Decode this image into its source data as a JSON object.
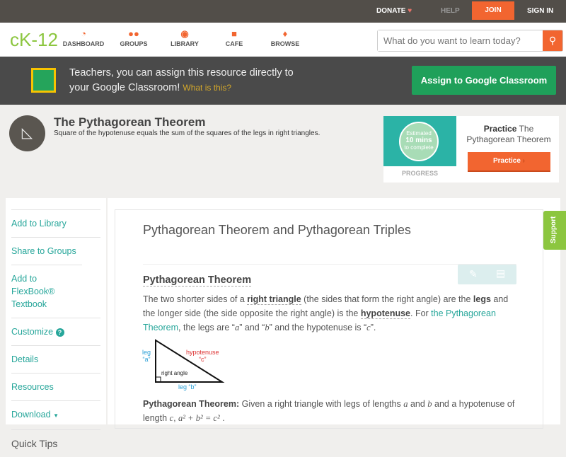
{
  "topbar": {
    "donate": "DONATE",
    "help": "HELP",
    "join": "JOIN",
    "signin": "SIGN IN"
  },
  "nav": {
    "logo": "cK-12",
    "items": [
      {
        "label": "DASHBOARD",
        "icon": "dashboard-icon"
      },
      {
        "label": "GROUPS",
        "icon": "groups-icon"
      },
      {
        "label": "LIBRARY",
        "icon": "library-icon"
      },
      {
        "label": "CAFE",
        "icon": "cafe-icon"
      },
      {
        "label": "BROWSE",
        "icon": "browse-icon"
      }
    ],
    "search_placeholder": "What do you want to learn today?"
  },
  "banner": {
    "line1": "Teachers, you can assign this resource directly to",
    "line2": "your Google Classroom!",
    "link": "What is this?",
    "button": "Assign to Google Classroom"
  },
  "concept": {
    "title": "The Pythagorean Theorem",
    "subtitle": "Square of the hypotenuse equals the sum of the squares of the legs in right triangles."
  },
  "practice": {
    "estimate1": "Estimated",
    "estimate2": "10 mins",
    "estimate3": "to complete",
    "progress": "PROGRESS",
    "title_bold": "Practice",
    "title_rest": " The Pythagorean Theorem",
    "button": "Practice"
  },
  "sidebar": {
    "items": [
      "Add to Library",
      "Share to Groups",
      "Add to FlexBook® Textbook",
      "Customize",
      "Details",
      "Resources",
      "Download"
    ],
    "quick_tips": "Quick Tips"
  },
  "support": "Support",
  "content": {
    "title": "Pythagorean Theorem and Pythagorean Triples",
    "heading": "Pythagorean Theorem",
    "p1": [
      "The two shorter sides of a ",
      "right triangle",
      " (the sides that form the right angle) are the ",
      "legs",
      " and the longer side (the side opposite the right angle) is the ",
      "hypotenuse",
      ". For ",
      "the Pythagorean Theorem",
      ", the legs are “",
      "a",
      "” and “",
      "b",
      "” and the hypotenuse is “",
      "c",
      "”."
    ],
    "diagram": {
      "leg_a1": "leg",
      "leg_a2": "“a”",
      "hyp1": "hypotenuse",
      "hyp2": "“c”",
      "right_angle": "right angle",
      "leg_b": "leg “b”"
    },
    "theorem_label": "Pythagorean Theorem:",
    "theorem_text": " Given a right triangle with legs of lengths ",
    "a": "a",
    "and": " and ",
    "b": "b",
    "theorem_text2": " and a hypotenuse of length ",
    "c": "c",
    "eq": "a² + b² = c²"
  }
}
